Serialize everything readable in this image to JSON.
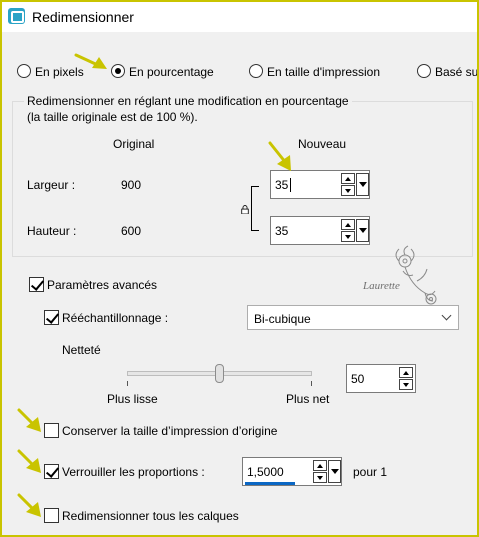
{
  "window": {
    "title": "Redimensionner"
  },
  "mode_radios": [
    {
      "label": "En pixels",
      "checked": false
    },
    {
      "label": "En pourcentage",
      "checked": true
    },
    {
      "label": "En taille d'impression",
      "checked": false
    },
    {
      "label": "Basé su",
      "checked": false
    }
  ],
  "group": {
    "title_line1": "Redimensionner en réglant une modification en pourcentage",
    "title_line2": "(la taille originale est de 100 %).",
    "col_original": "Original",
    "col_nouveau": "Nouveau",
    "rows": [
      {
        "label": "Largeur :",
        "original": "900",
        "value": "35"
      },
      {
        "label": "Hauteur :",
        "original": "600",
        "value": "35"
      }
    ]
  },
  "advanced": {
    "label": "Paramètres avancés",
    "checked": true,
    "resample_label": "Rééchantillonnage :",
    "resample_checked": true,
    "resample_value": "Bi-cubique",
    "sharpness_label": "Netteté",
    "sharpness_min_label": "Plus lisse",
    "sharpness_max_label": "Plus net",
    "sharpness_value": "50",
    "sharpness_level": 0.5
  },
  "options": {
    "keep_print_size": {
      "label": "Conserver la taille d’impression d’origine",
      "checked": false
    },
    "lock_ratio": {
      "label": "Verrouiller les proportions :",
      "checked": true,
      "value": "1,5000",
      "suffix": "pour 1"
    },
    "resize_all_layers": {
      "label": "Redimensionner tous les calques",
      "checked": false
    }
  },
  "watermark": {
    "text": "Laurette"
  },
  "colors": {
    "pointer_arrow": "#c9c400",
    "accent": "#0b67c4"
  }
}
